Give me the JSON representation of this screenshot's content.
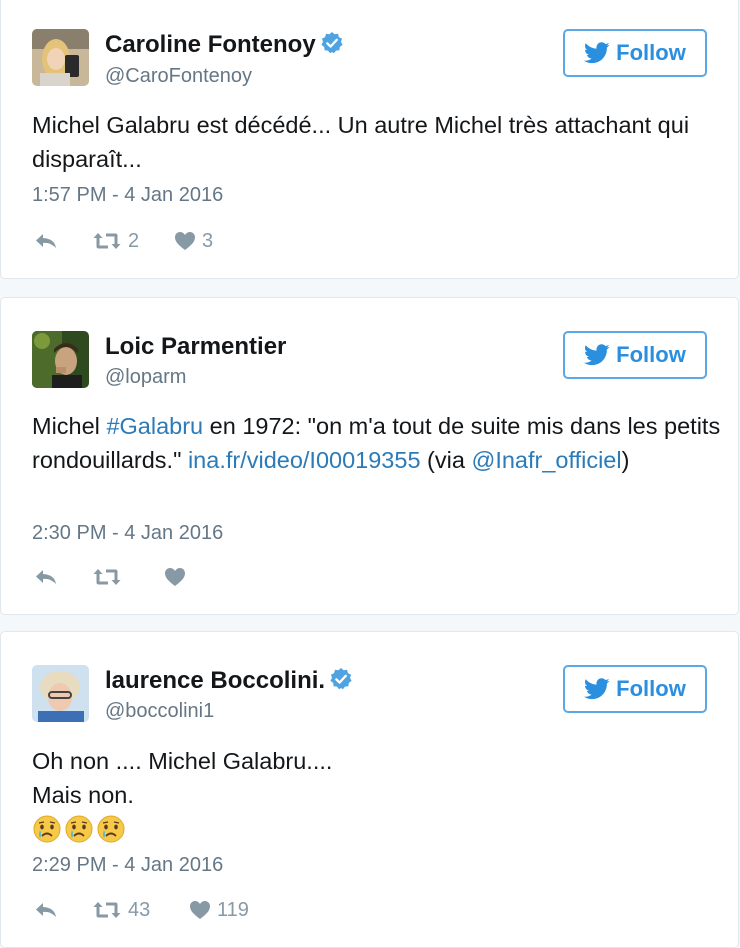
{
  "tweets": [
    {
      "name": "Caroline Fontenoy",
      "handle": "@CaroFontenoy",
      "verified": true,
      "follow_label": "Follow",
      "text": "Michel Galabru est décédé... Un autre Michel très attachant qui disparaît...",
      "timestamp": "1:57 PM - 4 Jan 2016",
      "retweets": "2",
      "likes": "3"
    },
    {
      "name": "Loic Parmentier",
      "handle": "@loparm",
      "verified": false,
      "follow_label": "Follow",
      "text_parts": {
        "p1": "Michel ",
        "hashtag": "#Galabru",
        "p2": " en 1972: \"on m'a tout de suite mis dans les petits rondouillards.\" ",
        "url": "ina.fr/video/I00019355",
        "p3": " (via ",
        "mention": "@Inafr_officiel",
        "p4": ")"
      },
      "timestamp": "2:30 PM - 4 Jan 2016",
      "retweets": "",
      "likes": ""
    },
    {
      "name": "laurence Boccolini.",
      "handle": "@boccolini1",
      "verified": true,
      "follow_label": "Follow",
      "text_lines": [
        "Oh non .... Michel Galabru....",
        "Mais non."
      ],
      "emojis": [
        "crying-face",
        "crying-face",
        "crying-face"
      ],
      "timestamp": "2:29 PM - 4 Jan 2016",
      "retweets": "43",
      "likes": "119"
    }
  ],
  "icons": {
    "reply": "reply-icon",
    "retweet": "retweet-icon",
    "like": "heart-icon",
    "verified": "verified-badge-icon",
    "bird": "twitter-bird-icon"
  },
  "colors": {
    "accent": "#2b8fe0",
    "link": "#2b7bb9",
    "verified": "#4ea3e0",
    "muted": "#8899a6"
  }
}
